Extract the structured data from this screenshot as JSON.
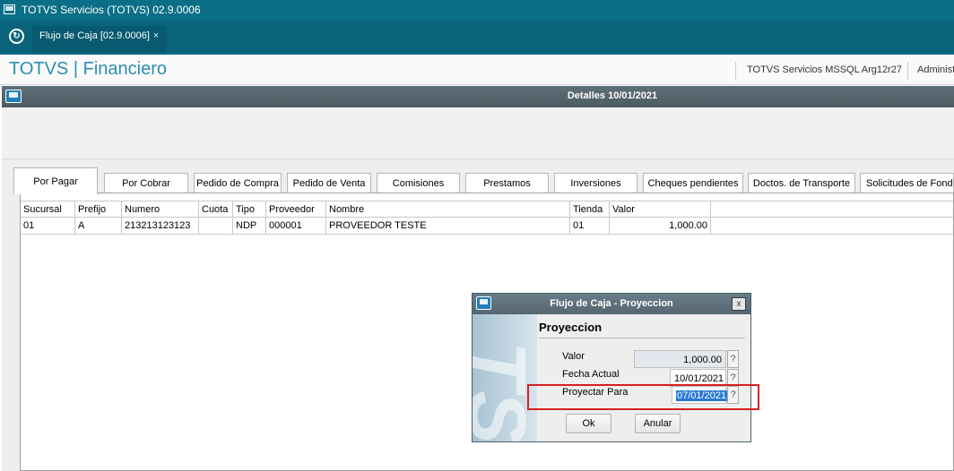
{
  "window": {
    "title": "TOTVS Servicios (TOTVS) 02.9.0006"
  },
  "tabs": [
    {
      "label": "Flujo de Caja [02.9.0006]",
      "close": "×"
    }
  ],
  "header": {
    "brand": "TOTVS | Financiero",
    "server": "TOTVS Servicios MSSQL Arg12r27",
    "user": "Administ"
  },
  "detail": {
    "title": "Detalles 10/01/2021"
  },
  "folder_tabs": [
    "Por Pagar",
    "Por Cobrar",
    "Pedido de Compra",
    "Pedido de Venta",
    "Comisiones",
    "Prestamos",
    "Inversiones",
    "Cheques pendientes",
    "Doctos. de Transporte",
    "Solicitudes de Fondo"
  ],
  "active_tab": "Por Pagar",
  "grid": {
    "columns": [
      "Sucursal",
      "Prefijo",
      "Numero",
      "Cuota",
      "Tipo",
      "Proveedor",
      "Nombre",
      "Tienda",
      "Valor"
    ],
    "rows": [
      [
        "01",
        "A",
        "213213123123",
        "",
        "NDP",
        "000001",
        "PROVEEDOR TESTE",
        "01",
        "1,000.00"
      ]
    ]
  },
  "dialog": {
    "title": "Flujo de Caja - Proyeccion",
    "close": "x",
    "section": "Proyeccion",
    "valor_label": "Valor",
    "valor": "1,000.00",
    "fecha_label": "Fecha Actual",
    "fecha": "10/01/2021",
    "proyectar_label": "Proyectar Para",
    "proyectar": "07/01/2021",
    "help": "?",
    "ok": "Ok",
    "anular": "Anular"
  },
  "colors": {
    "titlebar": "#0a6f86",
    "brand": "#2a8fb0",
    "highlight": "#d62020",
    "selection": "#2a7ad4"
  }
}
